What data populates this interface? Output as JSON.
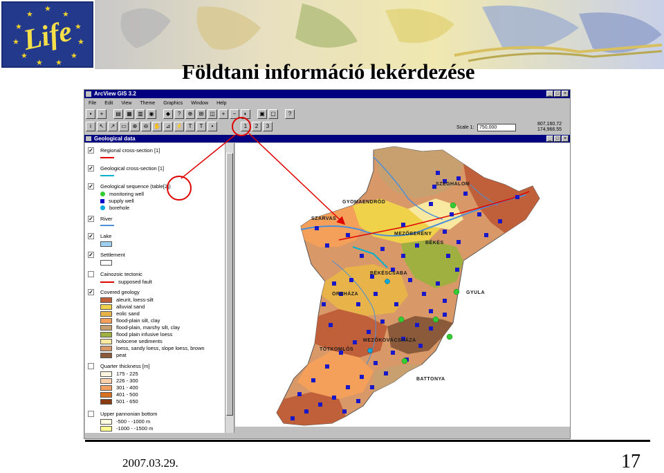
{
  "slide": {
    "title": "Földtani információ lekérdezése",
    "date": "2007.03.29.",
    "page_number": "17",
    "logo_text": "Life",
    "logo_icon": "eu-life-logo",
    "accent_color": "#e00000"
  },
  "window": {
    "title": "ArcView GIS 3.2",
    "view_title": "Geological data",
    "buttons": {
      "minimize": "_",
      "maximize": "□",
      "close": "×"
    }
  },
  "menu": [
    "File",
    "Edit",
    "View",
    "Theme",
    "Graphics",
    "Window",
    "Help"
  ],
  "toolbar": {
    "scale_label": "Scale 1:",
    "scale_value": "750,000",
    "coord_x": "807,160.72",
    "coord_y": "174,966.55",
    "highlight_tool_number": "2"
  },
  "toc": {
    "themes": [
      {
        "name": "Regional cross-section [1]",
        "checked": true,
        "symbol": "line",
        "color": "#e00000"
      },
      {
        "name": "Geological cross-section [1]",
        "checked": true,
        "symbol": "line",
        "color": "#00b0d0"
      },
      {
        "name": "Geological sequence (table[2])",
        "checked": true,
        "items": [
          {
            "label": "monitoring well",
            "symbol": "dot",
            "color": "#33cc33"
          },
          {
            "label": "supply well",
            "symbol": "square",
            "color": "#0000cc"
          },
          {
            "label": "borehole",
            "symbol": "dot",
            "color": "#00aadd"
          }
        ]
      },
      {
        "name": "River",
        "checked": true,
        "symbol": "line",
        "color": "#4a8fd8"
      },
      {
        "name": "Lake",
        "checked": true,
        "symbol": "swatch",
        "color": "#9fd0f0"
      },
      {
        "name": "Settlement",
        "checked": true,
        "symbol": "swatch",
        "color": "#ffffff"
      },
      {
        "name": "Cainozoic tectonic",
        "checked": false,
        "items": [
          {
            "label": "supposed fault",
            "symbol": "line",
            "color": "#e00000"
          }
        ]
      },
      {
        "name": "Covered geology",
        "checked": true,
        "items": [
          {
            "label": "aleurit, loess-silt",
            "color": "#c0603a"
          },
          {
            "label": "alluvial sand",
            "color": "#f0d24a"
          },
          {
            "label": "eolic sand",
            "color": "#e8b44a"
          },
          {
            "label": "flood-plain silt, clay",
            "color": "#f4a05a"
          },
          {
            "label": "flood-plain, marshy silt, clay",
            "color": "#c8a070"
          },
          {
            "label": "flood plain infusive loess",
            "color": "#a0b040"
          },
          {
            "label": "holocene sediments",
            "color": "#f8e8a0"
          },
          {
            "label": "loess, sandy loess, slope loess, brown",
            "color": "#d89868"
          },
          {
            "label": "peat",
            "color": "#8a5a3a"
          }
        ]
      },
      {
        "name": "Quarter thickness [m]",
        "checked": false,
        "items": [
          {
            "label": "175 - 225",
            "color": "#fff4e0"
          },
          {
            "label": "226 - 300",
            "color": "#fcd0a8"
          },
          {
            "label": "301 - 400",
            "color": "#f4a060"
          },
          {
            "label": "401 - 500",
            "color": "#d87020"
          },
          {
            "label": "501 - 650",
            "color": "#8a3a10"
          }
        ]
      },
      {
        "name": "Upper pannonian bottom",
        "checked": false,
        "items": [
          {
            "label": "-500 - -1000 m",
            "color": "#ffffe0"
          },
          {
            "label": "-1000 - -1500 m",
            "color": "#ffff90"
          }
        ]
      }
    ]
  },
  "map": {
    "labels": [
      {
        "text": "SZEGHALOM"
      },
      {
        "text": "GYOMAENDRŐD"
      },
      {
        "text": "SZARVAS"
      },
      {
        "text": "MEZŐBERÉNY"
      },
      {
        "text": "BÉKÉS"
      },
      {
        "text": "BÉKÉSCSABA"
      },
      {
        "text": "ORSHÁZA"
      },
      {
        "text": "GYULA"
      },
      {
        "text": "MEZŐKOVÁCSHÁZA"
      },
      {
        "text": "TÓTKOMLÓS"
      },
      {
        "text": "BATTONYA"
      }
    ]
  }
}
